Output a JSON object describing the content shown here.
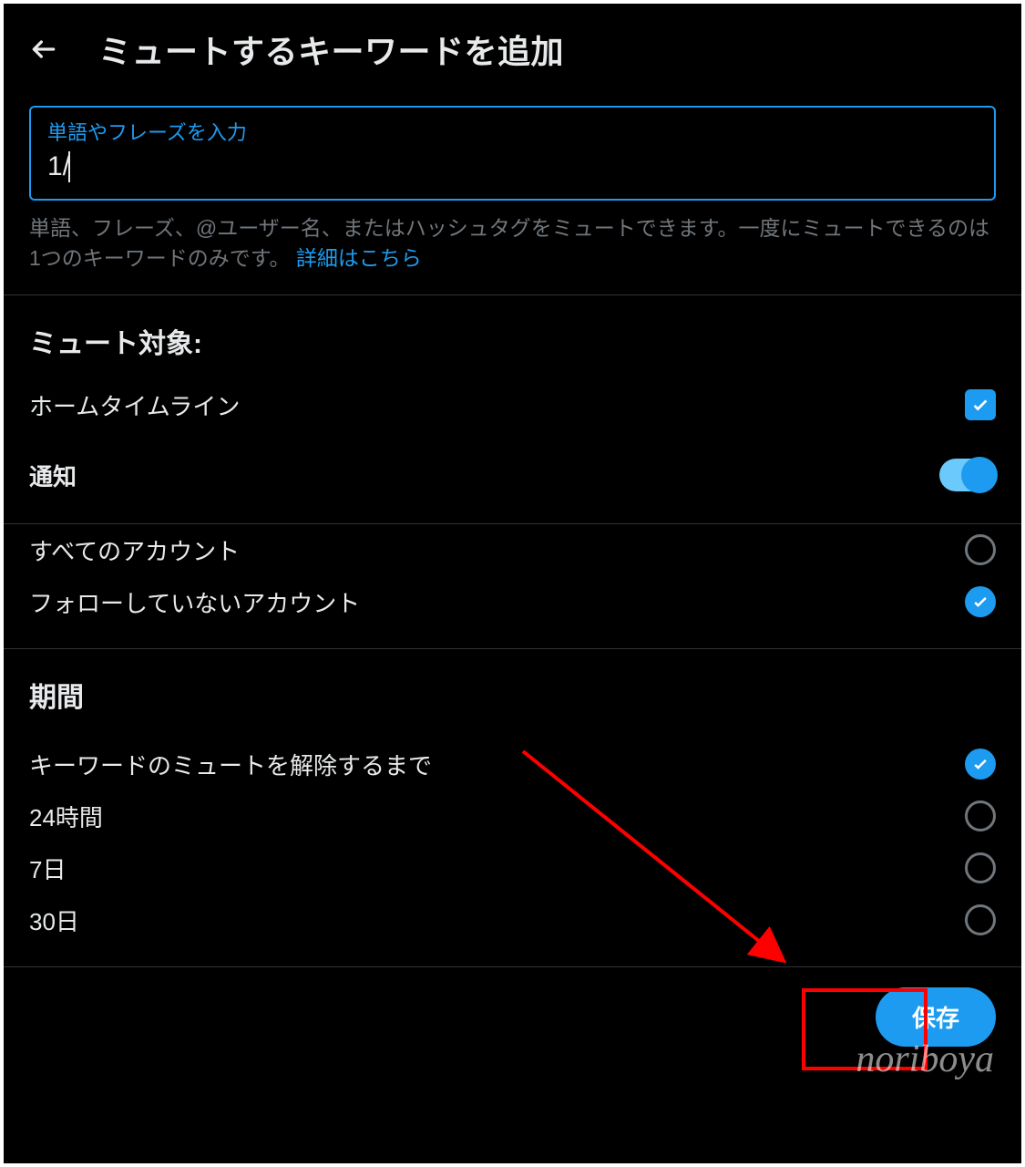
{
  "header": {
    "title": "ミュートするキーワードを追加"
  },
  "input": {
    "label": "単語やフレーズを入力",
    "value": "1/"
  },
  "helper": {
    "text_before": "単語、フレーズ、@ユーザー名、またはハッシュタグをミュートできます。一度にミュートできるのは1つのキーワードのみです。",
    "link_text": "詳細はこちら"
  },
  "mute_from": {
    "title": "ミュート対象:",
    "items": {
      "timeline": {
        "label": "ホームタイムライン",
        "checked": true
      },
      "notifications": {
        "label": "通知",
        "on": true
      }
    },
    "radios": {
      "all_accounts": {
        "label": "すべてのアカウント",
        "checked": false
      },
      "not_followed": {
        "label": "フォローしていないアカウント",
        "checked": true
      }
    }
  },
  "duration": {
    "title": "期間",
    "options": {
      "forever": {
        "label": "キーワードのミュートを解除するまで",
        "checked": true
      },
      "h24": {
        "label": "24時間",
        "checked": false
      },
      "d7": {
        "label": "7日",
        "checked": false
      },
      "d30": {
        "label": "30日",
        "checked": false
      }
    }
  },
  "footer": {
    "save_label": "保存"
  },
  "watermark": "noriboya"
}
